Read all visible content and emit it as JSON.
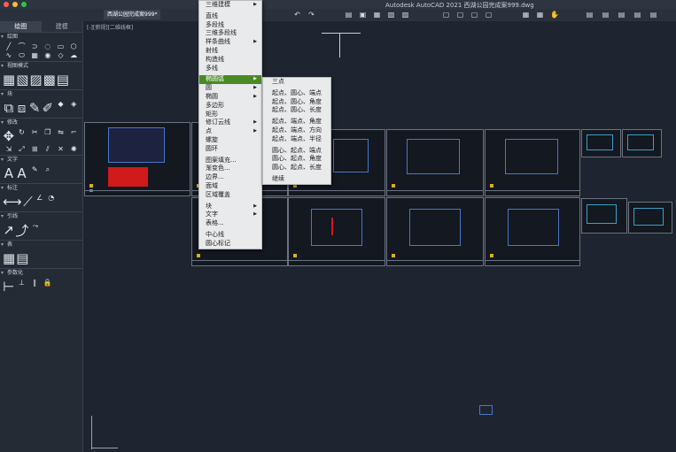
{
  "window": {
    "title": "Autodesk AutoCAD 2021   西湖公园完成案999.dwg"
  },
  "document_tab": "西湖公园完成案999*",
  "viewport_label": "[-][俯视][二维线框]",
  "palette": {
    "tabs": [
      {
        "label": "绘图",
        "active": true
      },
      {
        "label": "建模",
        "active": false
      }
    ],
    "sections": [
      {
        "title": "绘图",
        "tools": [
          "line-icon",
          "polyline-icon",
          "circle-icon",
          "arc-icon",
          "rectangle-icon",
          "polygon-icon",
          "spline-icon",
          "ellipse-icon",
          "hatch-icon",
          "point-icon",
          "region-icon",
          "revcloud-icon"
        ]
      },
      {
        "title": "视图模式",
        "tools": [
          "view-icon",
          "view2-icon",
          "view3-icon",
          "view4-icon",
          "view5-icon"
        ]
      },
      {
        "title": "块",
        "tools": [
          "insert-block-icon",
          "create-block-icon",
          "edit-block-icon",
          "attribute-icon"
        ]
      },
      {
        "title": "修改",
        "tools": [
          "move-icon",
          "rotate-icon",
          "trim-icon",
          "copy-icon",
          "mirror-icon",
          "fillet-icon",
          "stretch-icon",
          "scale-icon",
          "array-icon",
          "offset-icon",
          "erase-icon",
          "explode-icon"
        ]
      },
      {
        "title": "文字",
        "tools": [
          "text-icon",
          "text-style-icon",
          "text-edit-icon",
          "text-find-icon"
        ]
      },
      {
        "title": "标注",
        "tools": [
          "dim-linear-icon",
          "dim-aligned-icon",
          "dim-angular-icon",
          "dim-radius-icon"
        ]
      },
      {
        "title": "引线",
        "tools": [
          "leader-icon",
          "leader-add-icon",
          "leader-align-icon"
        ]
      },
      {
        "title": "表",
        "tools": [
          "table-icon",
          "table-style-icon"
        ]
      },
      {
        "title": "参数化",
        "tools": [
          "constraint-icon",
          "constraint2-icon",
          "constraint3-icon",
          "constraint4-icon"
        ]
      }
    ]
  },
  "main_menu": {
    "items": [
      {
        "label": "三维建模",
        "submenu": true
      },
      {
        "sep": true
      },
      {
        "label": "直线"
      },
      {
        "label": "多段线"
      },
      {
        "label": "三维多段线"
      },
      {
        "label": "样条曲线",
        "submenu": true
      },
      {
        "label": "射线"
      },
      {
        "label": "构造线"
      },
      {
        "label": "多线"
      },
      {
        "sep": true
      },
      {
        "label": "椭圆弧",
        "submenu": true,
        "active": true
      },
      {
        "label": "圆",
        "submenu": true
      },
      {
        "label": "椭圆",
        "submenu": true
      },
      {
        "label": "多边形"
      },
      {
        "label": "矩形"
      },
      {
        "label": "修订云线",
        "submenu": true
      },
      {
        "label": "点",
        "submenu": true
      },
      {
        "label": "螺旋"
      },
      {
        "label": "圆环"
      },
      {
        "sep": true
      },
      {
        "label": "图案填充..."
      },
      {
        "label": "渐变色..."
      },
      {
        "label": "边界..."
      },
      {
        "label": "面域"
      },
      {
        "label": "区域覆盖"
      },
      {
        "sep": true
      },
      {
        "label": "块",
        "submenu": true
      },
      {
        "label": "文字",
        "submenu": true
      },
      {
        "label": "表格..."
      },
      {
        "sep": true
      },
      {
        "label": "中心线"
      },
      {
        "label": "圆心标记"
      }
    ]
  },
  "sub_menu": {
    "items": [
      {
        "label": "三点"
      },
      {
        "sep": true
      },
      {
        "label": "起点、圆心、端点"
      },
      {
        "label": "起点、圆心、角度"
      },
      {
        "label": "起点、圆心、长度"
      },
      {
        "sep": true
      },
      {
        "label": "起点、端点、角度"
      },
      {
        "label": "起点、端点、方向"
      },
      {
        "label": "起点、端点、半径"
      },
      {
        "sep": true
      },
      {
        "label": "圆心、起点、端点"
      },
      {
        "label": "圆心、起点、角度"
      },
      {
        "label": "圆心、起点、长度"
      },
      {
        "sep": true
      },
      {
        "label": "继续"
      }
    ]
  },
  "toolbar_icons": [
    "undo-icon",
    "redo-icon",
    "print-icon",
    "preview-icon",
    "publish-icon",
    "save-icon",
    "save-as-icon",
    "layer-icon",
    "properties-icon",
    "match-icon",
    "hand-icon",
    "layer2-icon",
    "layer3-icon",
    "layer4-icon",
    "layer5-icon"
  ]
}
